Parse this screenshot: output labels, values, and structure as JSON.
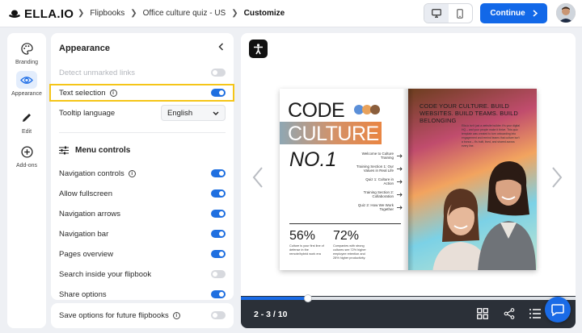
{
  "app": {
    "brand": "ELLA.IO"
  },
  "breadcrumb": [
    "Flipbooks",
    "Office culture quiz - US",
    "Customize"
  ],
  "header": {
    "continue_label": "Continue"
  },
  "rail": [
    {
      "label": "Branding",
      "icon": "palette-icon"
    },
    {
      "label": "Appearance",
      "icon": "eye-icon",
      "active": true
    },
    {
      "label": "Edit",
      "icon": "pencil-icon"
    },
    {
      "label": "Add-ons",
      "icon": "plus-circle-icon"
    }
  ],
  "panel": {
    "title": "Appearance",
    "detect_unmarked_links": {
      "label": "Detect unmarked links",
      "enabled": false,
      "disabled": true
    },
    "text_selection": {
      "label": "Text selection",
      "enabled": true
    },
    "tooltip_language": {
      "label": "Tooltip language",
      "value": "English"
    },
    "menu_controls_title": "Menu controls",
    "menu_controls": [
      {
        "label": "Navigation controls",
        "enabled": true,
        "info": true
      },
      {
        "label": "Allow fullscreen",
        "enabled": true
      },
      {
        "label": "Navigation arrows",
        "enabled": true
      },
      {
        "label": "Navigation bar",
        "enabled": true
      },
      {
        "label": "Pages overview",
        "enabled": true
      },
      {
        "label": "Search inside your flipbook",
        "enabled": false
      },
      {
        "label": "Share options",
        "enabled": true
      }
    ],
    "save_options": {
      "label": "Save options for future flipbooks",
      "enabled": false
    }
  },
  "preview": {
    "page_indicator": "2 - 3 / 10",
    "progress": 0.2,
    "left_page": {
      "title_line1": "CODE",
      "title_line2": "CULTURE",
      "title_line3": "NO.1",
      "toc": [
        "Welcome to Culture Training",
        "Training Section 1: Our Values in Real Life",
        "Quiz 1: Culture in Action",
        "Training Section 2: Collaboration",
        "Quiz 2: How We Work Together"
      ],
      "stats": [
        {
          "value": "56%",
          "caption": "Culture is your first line of defense in the remote/hybrid work era"
        },
        {
          "value": "72%",
          "caption": "Companies with strong cultures see 72% higher employee retention and 28% higher productivity."
        }
      ]
    },
    "right_page": {
      "heading": "CODE YOUR CULTURE. BUILD WEBSITES. BUILD TEAMS. BUILD BELONGING",
      "body": "Ella.io isn't just a website builder. It's your digital HQ – and your people make it thrive. This quiz template was created to turn onboarding into engagement and remind teams that culture isn't a bonus – it's built, lived, and shared across every line."
    }
  }
}
